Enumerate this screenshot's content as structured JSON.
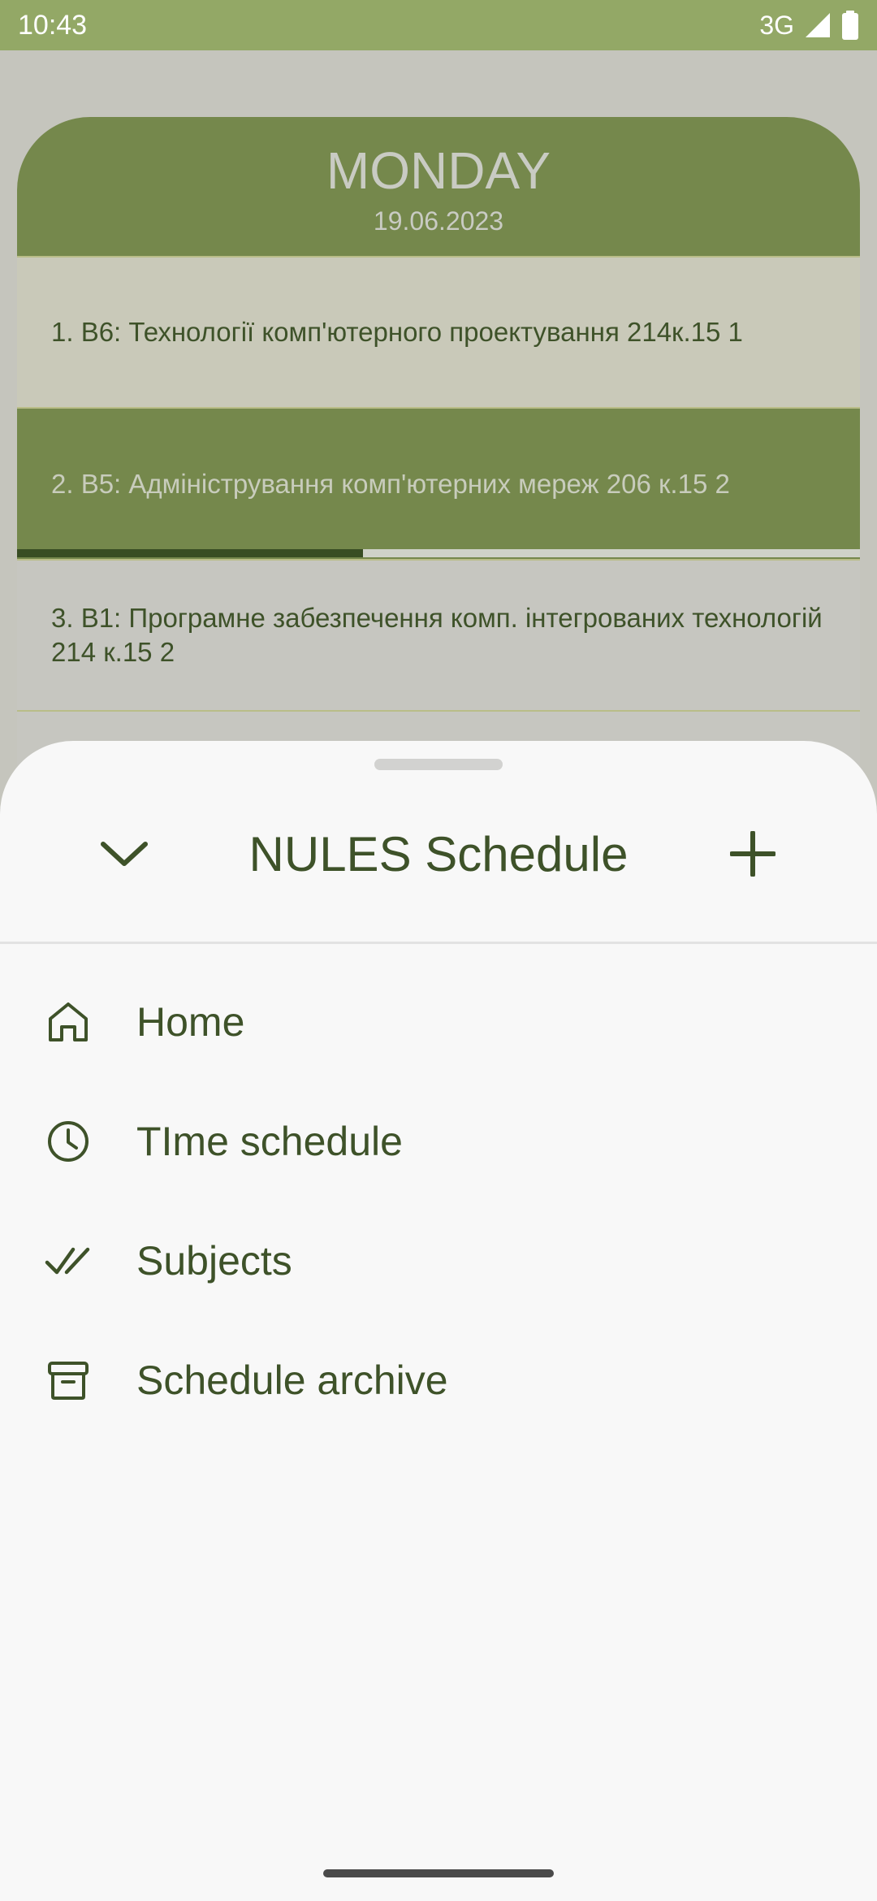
{
  "status_bar": {
    "time": "10:43",
    "network": "3G",
    "icons": [
      "signal-icon",
      "battery-icon"
    ]
  },
  "schedule": {
    "day": "MONDAY",
    "date": "19.06.2023",
    "lessons": [
      {
        "text": "1. В6: Технології комп'ютерного проектування 214к.15 1"
      },
      {
        "text": "2. В5: Адміністрування комп'ютерних мереж 206 к.15 2",
        "active": true,
        "progress": 0.41
      },
      {
        "text": "3. В1: Програмне забезпечення комп. інтегрованих технологій 214 к.15 2"
      }
    ]
  },
  "sheet": {
    "title": "NULES Schedule",
    "collapse_icon": "chevron-down-icon",
    "add_icon": "plus-icon",
    "menu": [
      {
        "label": "Home",
        "icon": "home-icon"
      },
      {
        "label": "TIme schedule",
        "icon": "clock-icon"
      },
      {
        "label": "Subjects",
        "icon": "double-check-icon"
      },
      {
        "label": "Schedule archive",
        "icon": "archive-icon"
      }
    ]
  },
  "colors": {
    "accent": "#75884c",
    "dark_text": "#3e5229",
    "status_bar": "#93a866"
  }
}
